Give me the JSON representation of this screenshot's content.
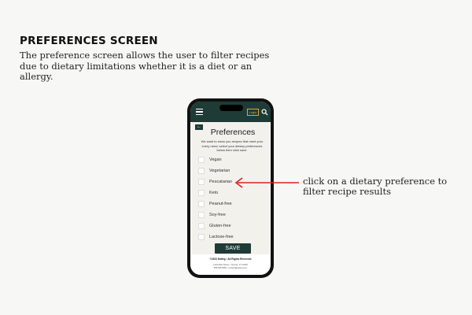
{
  "slide": {
    "heading": "PREFERENCES SCREEN",
    "description": "The preference screen allows the user to filter recipes due to dietary limitations whether it is a diet or an allergy.",
    "callout": "click on a dietary preference to filter recipe results",
    "accent_color": "#e02020"
  },
  "app": {
    "topbar": {
      "color": "#1f3b36",
      "menu_icon": "hamburger-menu-icon",
      "login_label": "Login",
      "search_icon": "search-icon"
    },
    "back_icon": "back-arrow-icon",
    "title": "Preferences",
    "intro": "We want to show you recipes that meet your every need; select your dietary preferences below then click save.",
    "options": [
      {
        "label": "Vegan",
        "checked": false
      },
      {
        "label": "Vegetarian",
        "checked": false
      },
      {
        "label": "Pescatarian",
        "checked": false
      },
      {
        "label": "Keto",
        "checked": false
      },
      {
        "label": "Peanut-free",
        "checked": false
      },
      {
        "label": "Soy-free",
        "checked": false
      },
      {
        "label": "Gluten-free",
        "checked": false
      },
      {
        "label": "Lactose-free",
        "checked": false
      }
    ],
    "save_label": "SAVE",
    "footer": {
      "copyright": "©2023 Eating • All Rights Reserved",
      "address": "1234 Main Street • Yourcity, ST 12345",
      "contact": "555.555.5555 • contact@eating.com"
    }
  }
}
